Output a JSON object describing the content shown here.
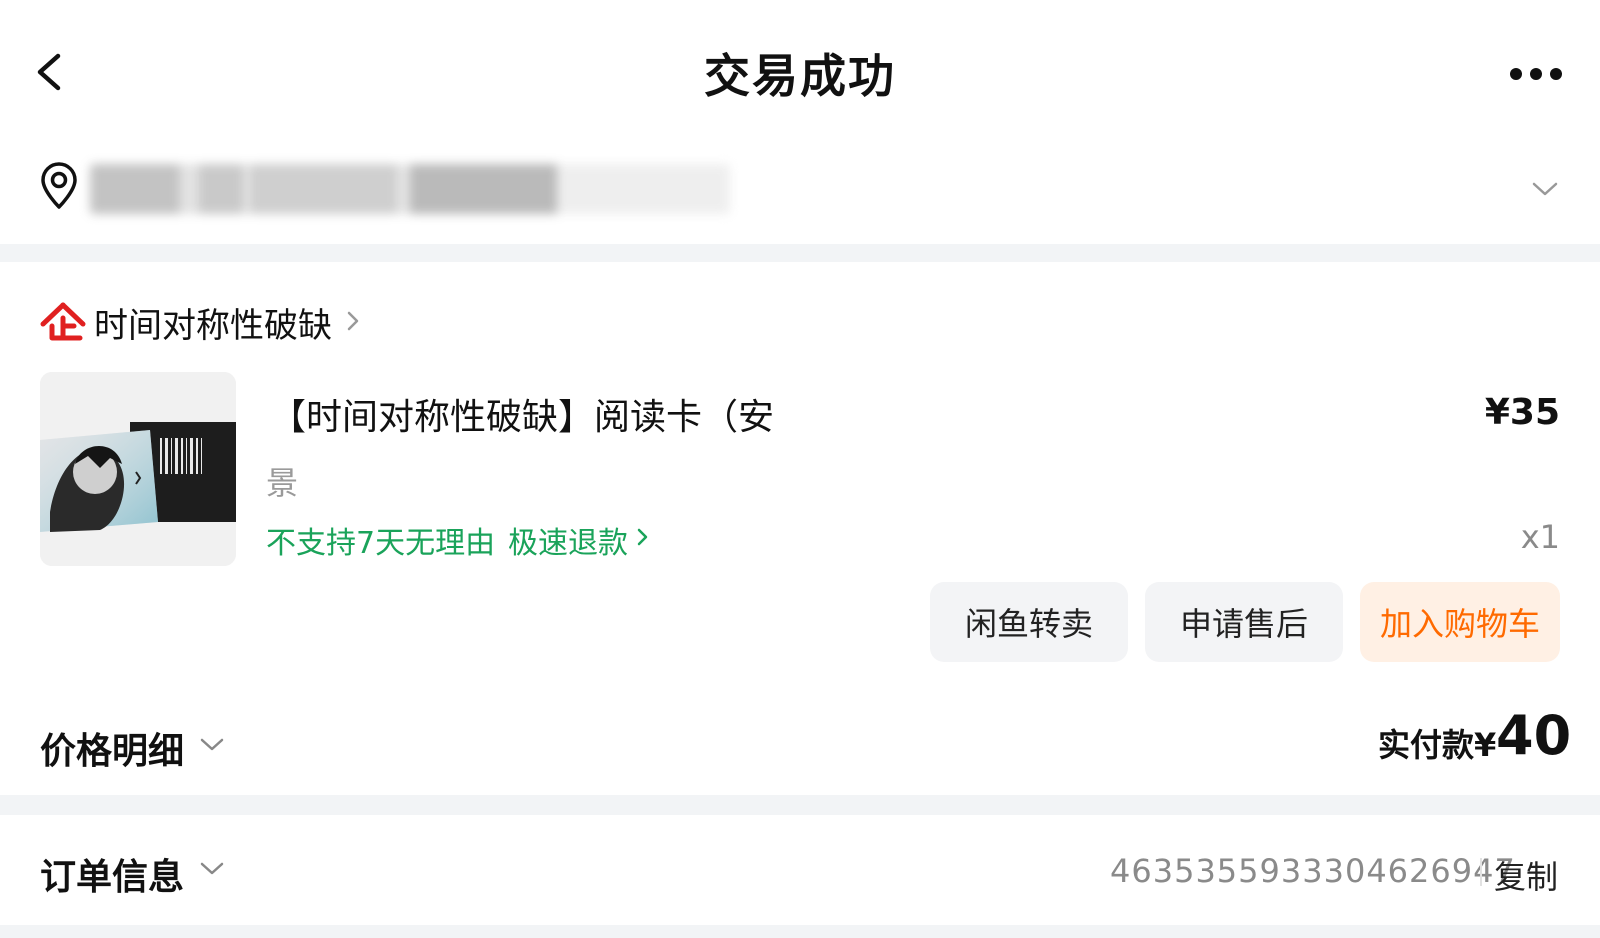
{
  "nav": {
    "title": "交易成功"
  },
  "address": {
    "text_obscured": true
  },
  "shop": {
    "logo_text": "企",
    "name": "时间对称性破缺"
  },
  "item": {
    "title_line1": "【时间对称性破缺】阅读卡（安",
    "title_line2": "景",
    "price": "¥35",
    "quantity": "x1",
    "tag_refund": "不支持7天无理由",
    "tag_fast_refund": "极速退款"
  },
  "actions": {
    "resell": "闲鱼转卖",
    "after_sales": "申请售后",
    "add_cart": "加入购物车"
  },
  "price_detail": {
    "label": "价格明细",
    "paid_label": "实付款¥",
    "paid_amount": "40"
  },
  "order": {
    "label": "订单信息",
    "number": "4635355933304626947",
    "copy": "复制"
  },
  "colors": {
    "accent_orange": "#ff6a00",
    "green": "#1aa35a",
    "shop_red": "#e02020"
  }
}
